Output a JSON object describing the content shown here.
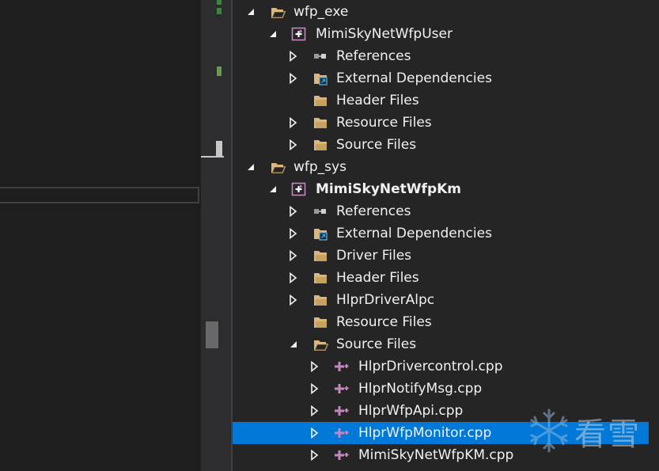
{
  "colors": {
    "background": "#1e1e1e",
    "tree_background": "#252526",
    "selection": "#0078d7",
    "folder": "#dcb67a",
    "project_icon": "#c586c0",
    "text": "#f1f1f1",
    "scroll_marker": "#388a34"
  },
  "solution_explorer": {
    "items": [
      {
        "label": "wfp_exe",
        "depth": 0,
        "expander": "expanded",
        "icon": "folder-open-icon"
      },
      {
        "label": "MimiSkyNetWfpUser",
        "depth": 1,
        "expander": "expanded",
        "icon": "vc-project-icon"
      },
      {
        "label": "References",
        "depth": 2,
        "expander": "collapsed",
        "icon": "references-icon"
      },
      {
        "label": "External Dependencies",
        "depth": 2,
        "expander": "collapsed",
        "icon": "external-deps-folder-icon"
      },
      {
        "label": "Header Files",
        "depth": 2,
        "expander": "none",
        "icon": "filter-folder-icon"
      },
      {
        "label": "Resource Files",
        "depth": 2,
        "expander": "collapsed",
        "icon": "filter-folder-icon"
      },
      {
        "label": "Source Files",
        "depth": 2,
        "expander": "collapsed",
        "icon": "filter-folder-icon"
      },
      {
        "label": "wfp_sys",
        "depth": 0,
        "expander": "expanded",
        "icon": "folder-open-icon"
      },
      {
        "label": "MimiSkyNetWfpKm",
        "depth": 1,
        "expander": "expanded",
        "icon": "vc-project-icon",
        "bold": true
      },
      {
        "label": "References",
        "depth": 2,
        "expander": "collapsed",
        "icon": "references-icon"
      },
      {
        "label": "External Dependencies",
        "depth": 2,
        "expander": "collapsed",
        "icon": "external-deps-folder-icon"
      },
      {
        "label": "Driver Files",
        "depth": 2,
        "expander": "collapsed",
        "icon": "filter-folder-icon"
      },
      {
        "label": "Header Files",
        "depth": 2,
        "expander": "collapsed",
        "icon": "filter-folder-icon"
      },
      {
        "label": "HlprDriverAlpc",
        "depth": 2,
        "expander": "collapsed",
        "icon": "filter-folder-icon"
      },
      {
        "label": "Resource Files",
        "depth": 2,
        "expander": "none",
        "icon": "filter-folder-icon"
      },
      {
        "label": "Source Files",
        "depth": 2,
        "expander": "expanded",
        "icon": "filter-folder-open-icon"
      },
      {
        "label": "HlprDrivercontrol.cpp",
        "depth": 3,
        "expander": "collapsed",
        "icon": "cpp-file-icon"
      },
      {
        "label": "HlprNotifyMsg.cpp",
        "depth": 3,
        "expander": "collapsed",
        "icon": "cpp-file-icon"
      },
      {
        "label": "HlprWfpApi.cpp",
        "depth": 3,
        "expander": "collapsed",
        "icon": "cpp-file-icon"
      },
      {
        "label": "HlprWfpMonitor.cpp",
        "depth": 3,
        "expander": "collapsed",
        "icon": "cpp-file-icon",
        "selected": true
      },
      {
        "label": "MimiSkyNetWfpKM.cpp",
        "depth": 3,
        "expander": "collapsed",
        "icon": "cpp-file-icon"
      }
    ]
  },
  "watermark": {
    "text": "看雪",
    "icon": "snowflake-icon"
  }
}
